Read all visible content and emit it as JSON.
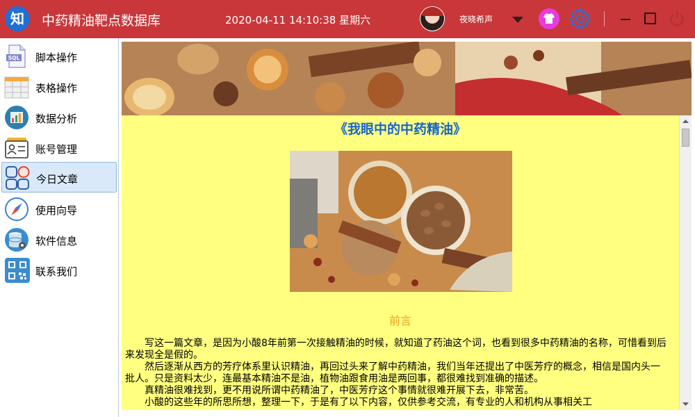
{
  "window": {
    "logo_glyph": "知",
    "title": "中药精油靶点数据库",
    "datetime": "2020-04-11 14:10:38 星期六",
    "username": "夜晓希声"
  },
  "colors": {
    "titlebar": "#c9373a",
    "accent_blue": "#1e6fd8",
    "article_bg": "#ffff80",
    "article_title": "#1a66cc",
    "section_heading": "#f0a020"
  },
  "sidebar": {
    "items": [
      {
        "label": "脚本操作",
        "icon": "sql-file-icon"
      },
      {
        "label": "表格操作",
        "icon": "table-icon"
      },
      {
        "label": "数据分析",
        "icon": "chart-icon"
      },
      {
        "label": "账号管理",
        "icon": "id-card-icon"
      },
      {
        "label": "今日文章",
        "icon": "article-icon",
        "active": true
      },
      {
        "label": "使用向导",
        "icon": "compass-icon"
      },
      {
        "label": "软件信息",
        "icon": "database-gear-icon"
      },
      {
        "label": "联系我们",
        "icon": "qr-code-icon"
      }
    ]
  },
  "article": {
    "title": "《我眼中的中药精油》",
    "section_heading": "前言",
    "paragraphs": [
      "写这一篇文章，是因为小酸8年前第一次接触精油的时候，就知道了药油这个词，也看到很多中药精油的名称，可惜看到后来发现全是假的。",
      "然后逐渐从西方的芳疗体系里认识精油，再回过头来了解中药精油，我们当年还提出了中医芳疗的概念，相信是国内头一批人。只是资料太少，连最基本精油不是油，植物油跟食用油是两回事，都很难找到准确的描述。",
      "真精油很难找到，更不用说所谓中药精油了，中医芳疗这个事情就很难开展下去，非常苦。",
      "小酸的这些年的所思所想，整理一下，于是有了以下内容，仅供参考交流，有专业的人和机构从事相关工"
    ]
  }
}
